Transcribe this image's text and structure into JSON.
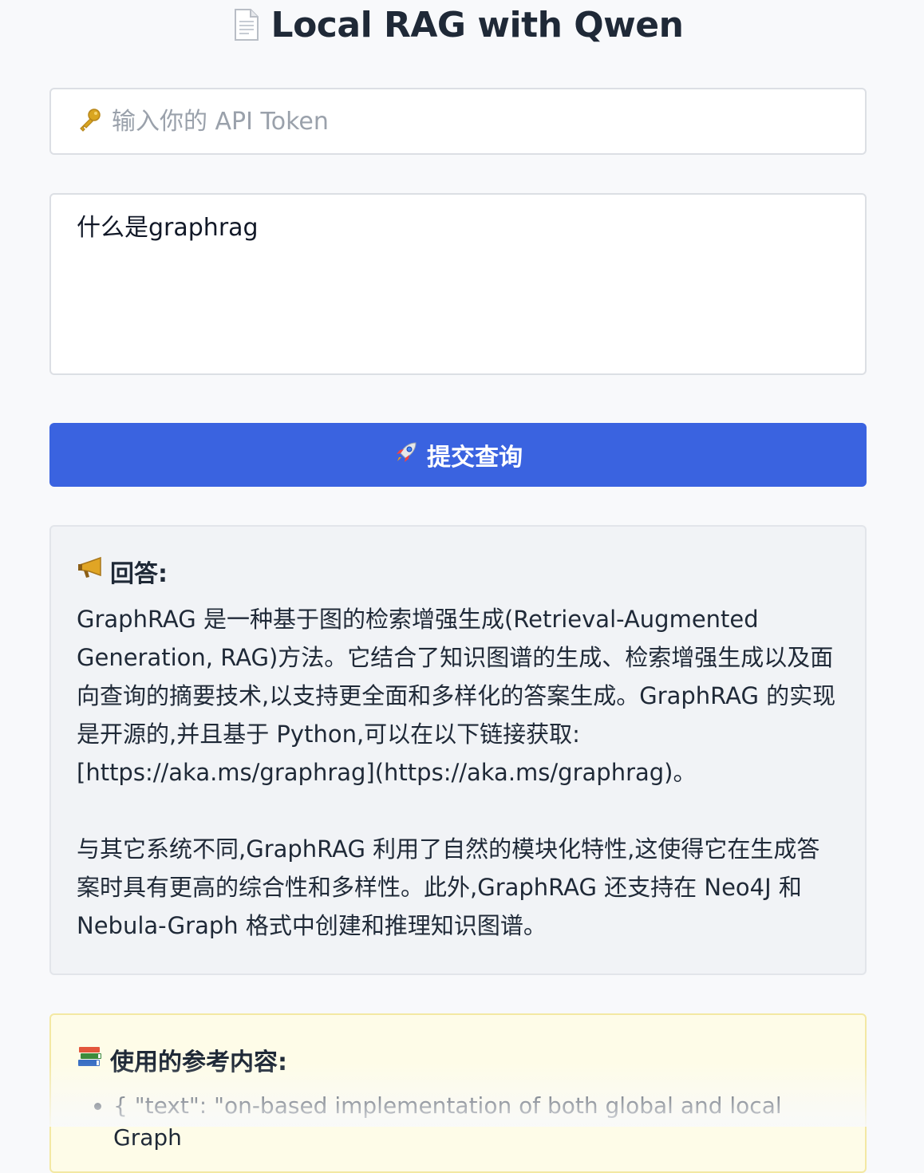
{
  "page": {
    "title": "Local RAG with Qwen"
  },
  "token": {
    "placeholder": "输入你的 API Token",
    "icon": "key-icon"
  },
  "query": {
    "value": "什么是graphrag"
  },
  "submit": {
    "label": "提交查询",
    "icon": "rocket-icon",
    "color": "#3a63e0"
  },
  "answer": {
    "heading": "回答:",
    "icon": "megaphone-icon",
    "paragraphs": [
      "GraphRAG 是一种基于图的检索增强生成(Retrieval-Augmented Generation, RAG)方法。它结合了知识图谱的生成、检索增强生成以及面向查询的摘要技术,以支持更全面和多样化的答案生成。GraphRAG 的实现是开源的,并且基于 Python,可以在以下链接获取:[https://aka.ms/graphrag](https://aka.ms/graphrag)。",
      "与其它系统不同,GraphRAG 利用了自然的模块化特性,这使得它在生成答案时具有更高的综合性和多样性。此外,GraphRAG 还支持在 Neo4J 和 Nebula-Graph 格式中创建和推理知识图谱。"
    ]
  },
  "references": {
    "heading": "使用的参考内容:",
    "icon": "books-icon",
    "items": [
      "{ \"text\": \"on-based implementation of both global and local Graph"
    ]
  }
}
